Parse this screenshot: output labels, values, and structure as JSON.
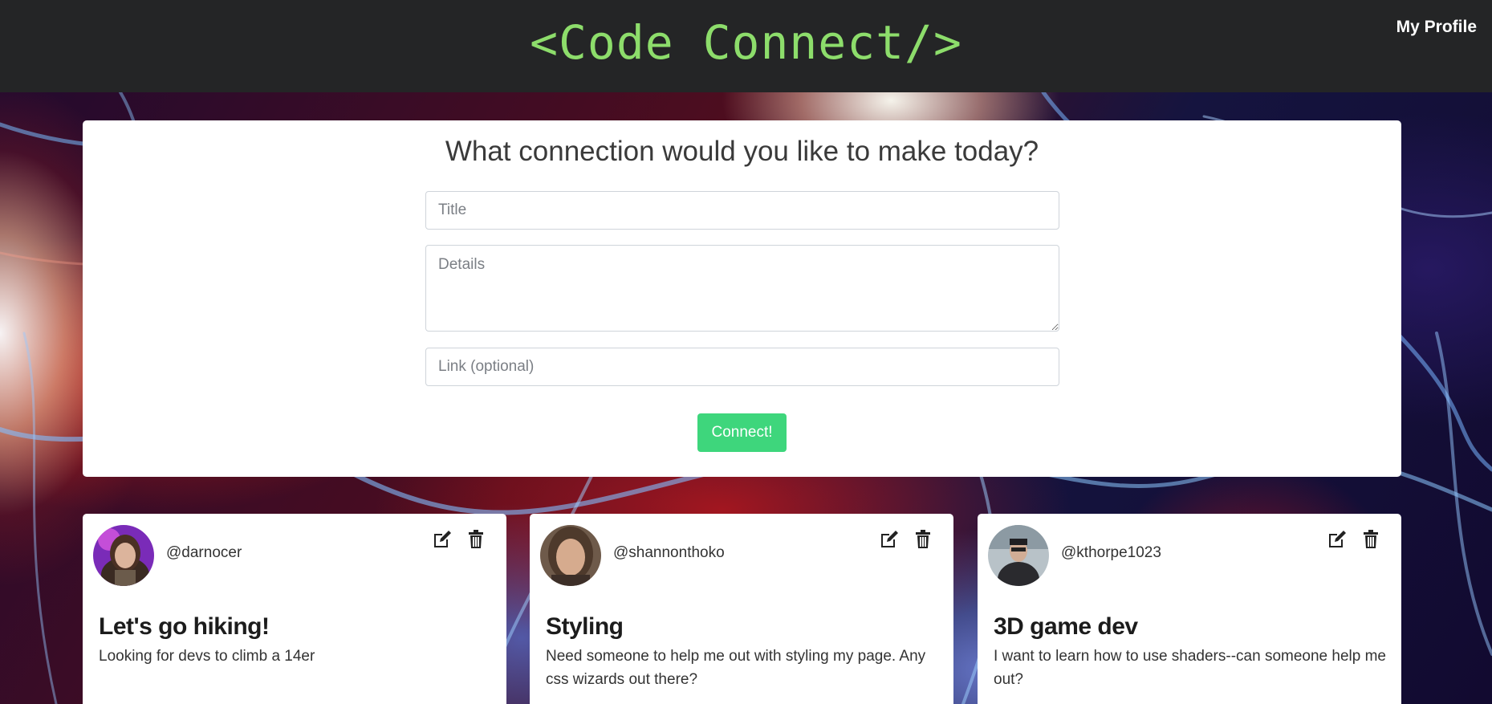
{
  "header": {
    "logo": "<Code Connect/>",
    "profile_link": "My Profile"
  },
  "form": {
    "heading": "What connection would you like to make today?",
    "title_placeholder": "Title",
    "details_placeholder": "Details",
    "link_placeholder": "Link (optional)",
    "submit_label": "Connect!"
  },
  "posts": [
    {
      "username": "@darnocer",
      "title": "Let's go hiking!",
      "details": "Looking for devs to climb a 14er",
      "actions": [
        "edit-icon",
        "trash-icon"
      ]
    },
    {
      "username": "@shannonthoko",
      "title": "Styling",
      "details": "Need someone to help me out with styling my page. Any css wizards out there?",
      "actions": [
        "edit-icon",
        "trash-icon"
      ]
    },
    {
      "username": "@kthorpe1023",
      "title": "3D game dev",
      "details": "I want to learn how to use shaders--can someone help me out?",
      "actions": [
        "edit-icon",
        "trash-icon"
      ]
    }
  ],
  "colors": {
    "navbar": "#242526",
    "logo": "#8ddd6b",
    "button": "#3ed67c"
  }
}
